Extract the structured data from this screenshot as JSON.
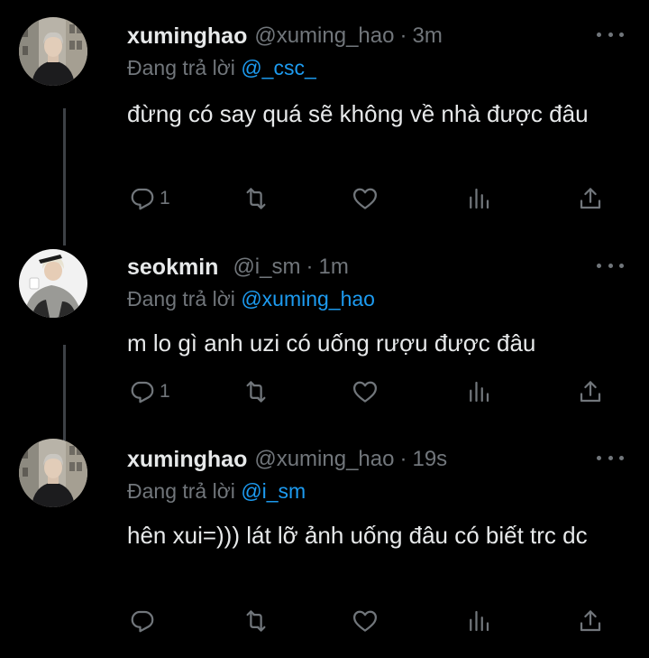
{
  "tweets": [
    {
      "name": "xuminghao",
      "handle": "@xuming_hao",
      "time": "3m",
      "reply_prefix": "Đang trả lời",
      "reply_to": "@_csc_",
      "text": "đừng có say quá sẽ không về nhà được đâu",
      "reply_count": "1",
      "avatar": "person-dark-coat-street"
    },
    {
      "name": "seokmin",
      "handle": "@i_sm",
      "time": "1m",
      "reply_prefix": "Đang trả lời",
      "reply_to": "@xuming_hao",
      "text": "m lo gì anh uzi có uống rượu được đâu",
      "reply_count": "1",
      "avatar": "person-crouching-grey-jacket"
    },
    {
      "name": "xuminghao",
      "handle": "@xuming_hao",
      "time": "19s",
      "reply_prefix": "Đang trả lời",
      "reply_to": "@i_sm",
      "text": "hên xui=))) lát lỡ ảnh uống đâu có biết trc dc",
      "reply_count": "",
      "avatar": "person-dark-coat-street"
    }
  ],
  "separator": "·",
  "icons": {
    "reply": "reply-icon",
    "retweet": "retweet-icon",
    "like": "like-icon",
    "views": "views-icon",
    "share": "share-icon",
    "more": "more-icon"
  },
  "colors": {
    "background": "#000000",
    "text": "#e7e9ea",
    "secondary": "#71767b",
    "mention": "#1d9bf0",
    "thread_line": "#3d4146"
  }
}
